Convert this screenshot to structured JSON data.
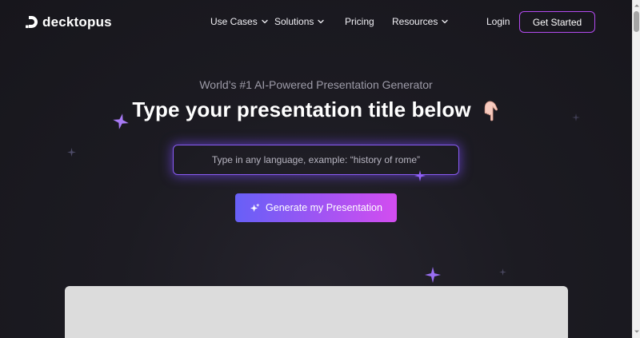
{
  "header": {
    "brand": "decktopus",
    "nav": [
      {
        "label": "Use Cases",
        "has_dropdown": true
      },
      {
        "label": "Solutions",
        "has_dropdown": true
      },
      {
        "label": "Pricing",
        "has_dropdown": false
      },
      {
        "label": "Resources",
        "has_dropdown": true
      }
    ],
    "login_label": "Login",
    "cta_label": "Get Started"
  },
  "hero": {
    "eyebrow": "World’s #1 AI-Powered Presentation Generator",
    "headline": "Type your presentation title below",
    "headline_emoji": "pointing-down-hand-icon",
    "input_placeholder": "Type in any language, example: “history of rome”",
    "input_value": "",
    "button_label": "Generate my Presentation"
  },
  "colors": {
    "background": "#1c1b22",
    "accent_purple": "#8a5cf6",
    "cta_border": "#b34bf0",
    "button_gradient_start": "#6760f7",
    "button_gradient_end": "#d34df0",
    "sparkle": "#a77af4",
    "preview_placeholder": "#dcdcdc"
  }
}
